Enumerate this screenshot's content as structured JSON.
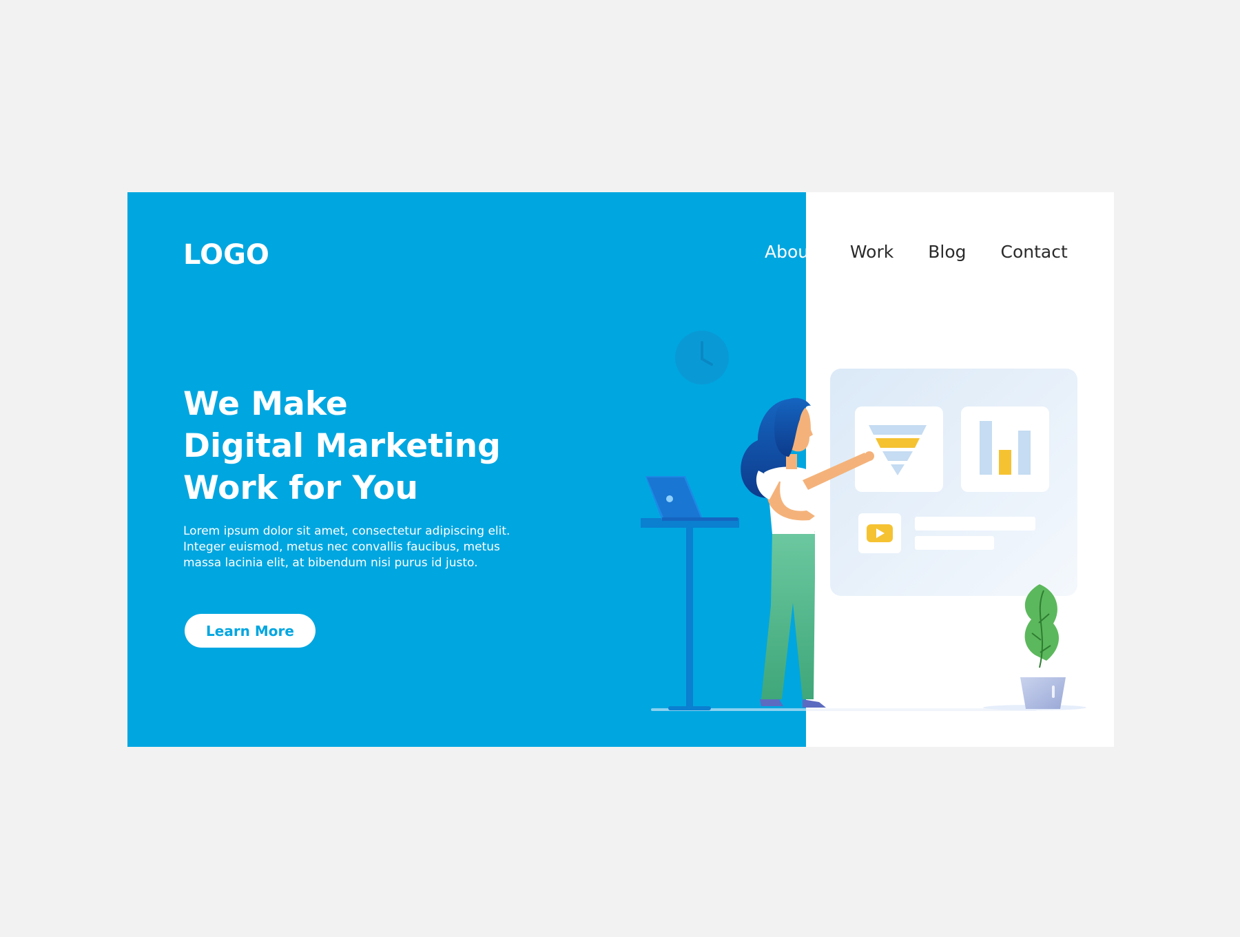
{
  "brand": {
    "logo_text": "LOGO"
  },
  "nav": {
    "items": [
      {
        "label": "About"
      },
      {
        "label": "Work"
      },
      {
        "label": "Blog"
      },
      {
        "label": "Contact"
      }
    ]
  },
  "hero": {
    "title_lines": [
      "We Make",
      "Digital Marketing",
      "Work for You"
    ],
    "body_lines": [
      "Lorem ipsum dolor sit amet, consectetur adipiscing elit.",
      "Integer euismod, metus nec convallis faucibus, metus",
      "massa lacinia elit, at bibendum nisi purus id justo."
    ],
    "cta_label": "Learn More"
  },
  "colors": {
    "page_background": "#f2f2f2",
    "hero_blue": "#00a6e0",
    "card_white": "#ffffff",
    "accent_yellow": "#f5c232",
    "plant_green": "#4caf50",
    "pants_green": "#5cbf8a"
  },
  "illustration": {
    "icons": [
      "clock-icon",
      "laptop-icon",
      "funnel-icon",
      "bar-chart-icon",
      "play-icon",
      "plant-icon"
    ]
  }
}
